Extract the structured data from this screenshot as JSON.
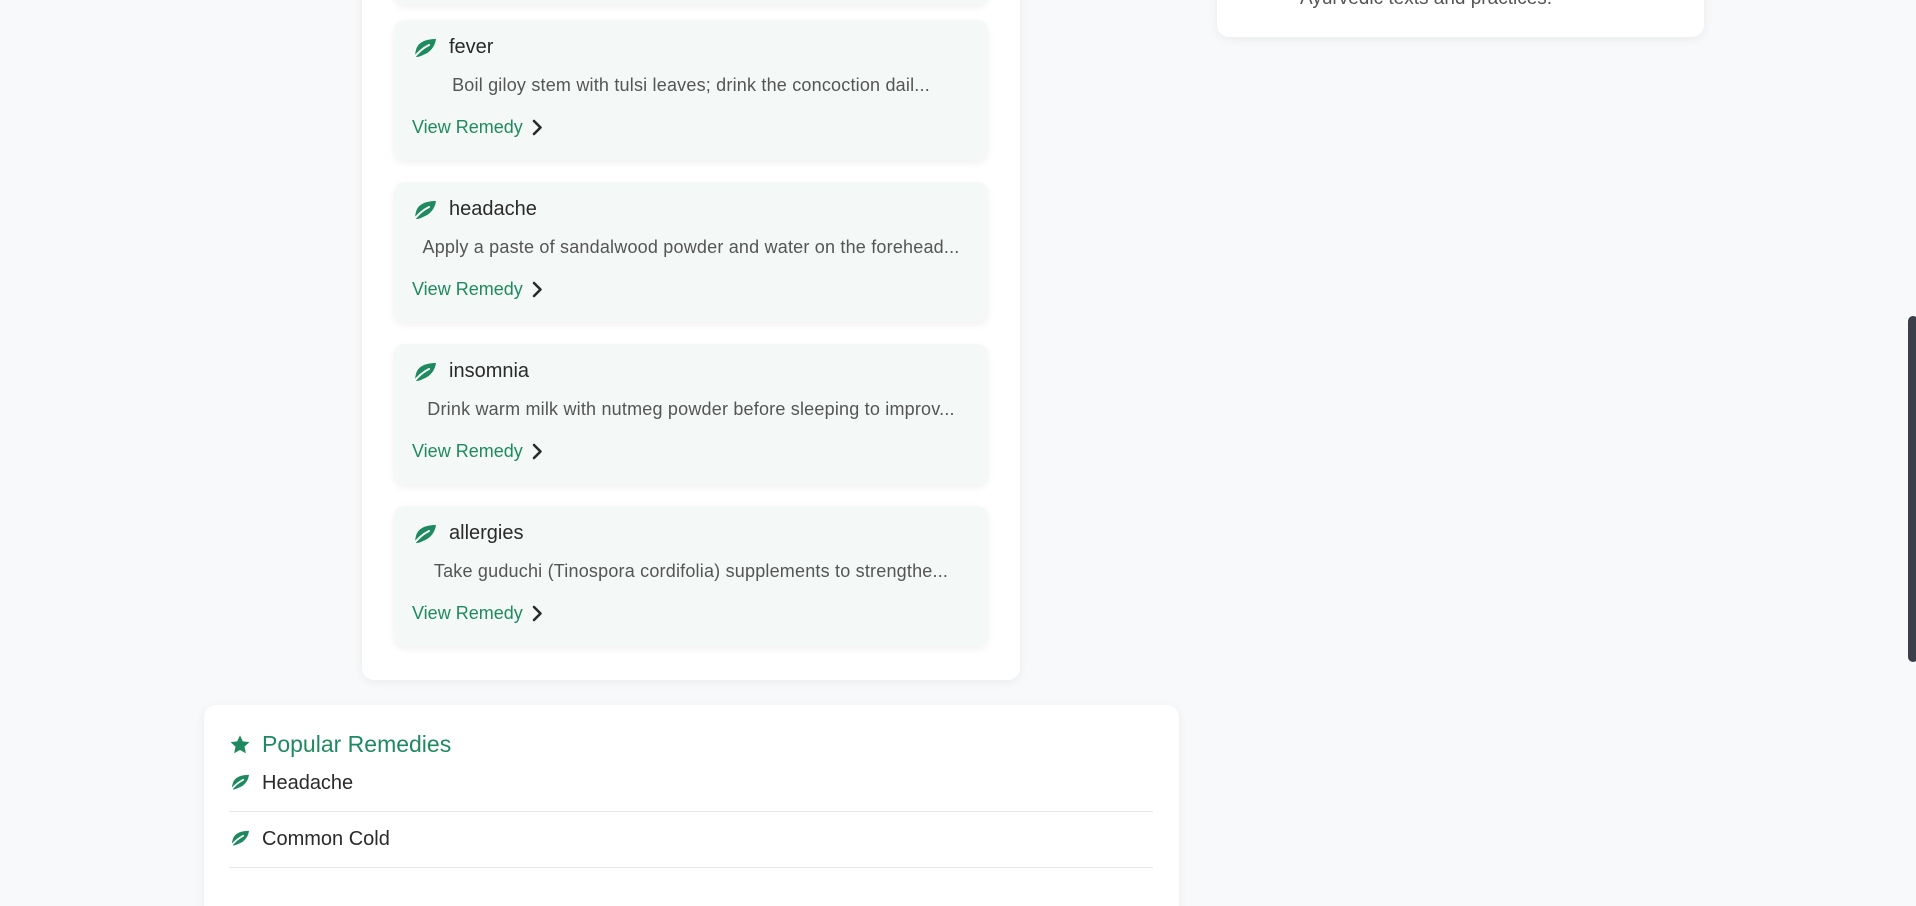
{
  "info_card": {
    "text": "Ayurvedic texts and practices."
  },
  "remedies": [
    {
      "title": "fever",
      "description": "Boil giloy stem with tulsi leaves; drink the concoction dail...",
      "link_label": "View Remedy"
    },
    {
      "title": "headache",
      "description": "Apply a paste of sandalwood powder and water on the forehead...",
      "link_label": "View Remedy"
    },
    {
      "title": "insomnia",
      "description": "Drink warm milk with nutmeg powder before sleeping to improv...",
      "link_label": "View Remedy"
    },
    {
      "title": "allergies",
      "description": "Take guduchi (Tinospora cordifolia) supplements to strengthe...",
      "link_label": "View Remedy"
    }
  ],
  "popular": {
    "title": "Popular Remedies",
    "items": [
      {
        "label": "Headache"
      },
      {
        "label": "Common Cold"
      }
    ]
  },
  "colors": {
    "accent": "#1f8a5f",
    "card_bg": "#f4f9f7",
    "page_bg": "#f8f9fa"
  },
  "icons": {
    "remedy_icon": "leaf-icon",
    "link_icon": "chevron-right-icon",
    "popular_icon": "star-icon"
  }
}
